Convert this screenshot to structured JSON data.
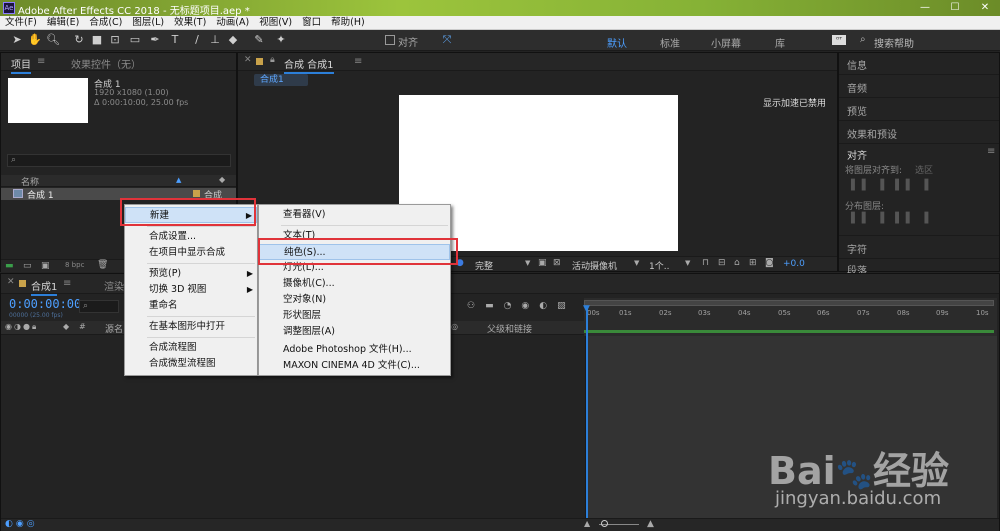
{
  "window": {
    "title": "Adobe After Effects CC 2018 - 无标题项目.aep *",
    "app_icon": "Ae"
  },
  "menubar": [
    "文件(F)",
    "编辑(E)",
    "合成(C)",
    "图层(L)",
    "效果(T)",
    "动画(A)",
    "视图(V)",
    "窗口",
    "帮助(H)"
  ],
  "toolbar": {
    "align_label": "对齐",
    "workspaces": [
      "默认",
      "标准",
      "小屏幕",
      "库"
    ],
    "search_placeholder": "搜索帮助"
  },
  "project_panel": {
    "tab_project": "项目",
    "tab_effects": "效果控件（无）",
    "comp_name": "合成 1",
    "comp_info_1": "1920 x1080 (1.00)",
    "comp_info_2": "Δ 0:00:10:00, 25.00 fps",
    "col_name": "名称",
    "item_name": "合成 1",
    "item_type": "合成",
    "bpc": "8 bpc"
  },
  "comp_panel": {
    "tab": "合成 合成1",
    "breadcrumb": "合成1",
    "gpu_notice": "显示加速已禁用",
    "resolution": "完整",
    "camera": "活动摄像机",
    "views": "1个..",
    "exposure": "+0.0"
  },
  "right_panel": {
    "items": [
      "信息",
      "音频",
      "预览",
      "效果和预设"
    ],
    "align_title": "对齐",
    "align_to_label": "将图层对齐到:",
    "align_to_value": "选区",
    "distribute_label": "分布图层:",
    "items_bottom": [
      "字符",
      "段落"
    ]
  },
  "timeline": {
    "tab": "合成1",
    "tab2": "渲染",
    "timecode": "0:00:00:00",
    "fps_note": "00000 (25.00 fps)",
    "col_source": "源名",
    "col_parent": "父级和链接",
    "ruler": [
      "00s",
      "01s",
      "02s",
      "03s",
      "04s",
      "05s",
      "06s",
      "07s",
      "08s",
      "09s",
      "10s"
    ]
  },
  "context_menu": {
    "items": [
      "新建",
      "合成设置...",
      "在项目中显示合成",
      "预览(P)",
      "切换 3D 视图",
      "重命名",
      "在基本图形中打开",
      "合成流程图",
      "合成微型流程图"
    ]
  },
  "submenu": {
    "items": [
      "查看器(V)",
      "文本(T)",
      "纯色(S)...",
      "灯光(L)...",
      "摄像机(C)...",
      "空对象(N)",
      "形状图层",
      "调整图层(A)",
      "Adobe Photoshop 文件(H)...",
      "MAXON CINEMA 4D 文件(C)..."
    ]
  },
  "watermark": {
    "brand": "Bai",
    "brand2": "经验",
    "url": "jingyan.baidu.com"
  },
  "colors": {
    "accent": "#2c7fd9",
    "highlight_box": "#e0333a",
    "work_area": "#3a8a3a"
  }
}
